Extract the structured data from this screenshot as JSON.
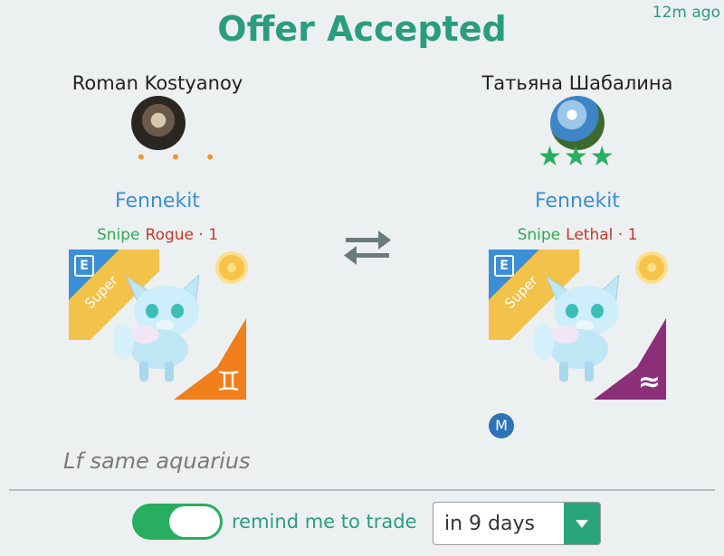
{
  "header": {
    "title": "Offer Accepted",
    "time_ago": "12m ago"
  },
  "left": {
    "user_name": "Roman Kostyanoy",
    "rating": "• • •",
    "pokemon_name": "Fennekit",
    "tag1": "Snipe",
    "tag2": "Rogue · 1",
    "ribbon_text": "Super",
    "badge_letter": "E",
    "corner_symbol": "♊"
  },
  "right": {
    "user_name": "Татьяна Шабалина",
    "rating": "★★★",
    "pokemon_name": "Fennekit",
    "tag1": "Snipe",
    "tag2": "Lethal · 1",
    "ribbon_text": "Super",
    "badge_letter": "E",
    "corner_symbol": "≈",
    "m_badge": "M"
  },
  "note": "Lf same aquarius",
  "footer": {
    "remind_label": "remind me to trade",
    "toggle_on": true,
    "select_value": "in 9 days"
  },
  "colors": {
    "accent": "#2a9d7e",
    "link": "#3a8fd1",
    "toggle": "#27ae60"
  }
}
